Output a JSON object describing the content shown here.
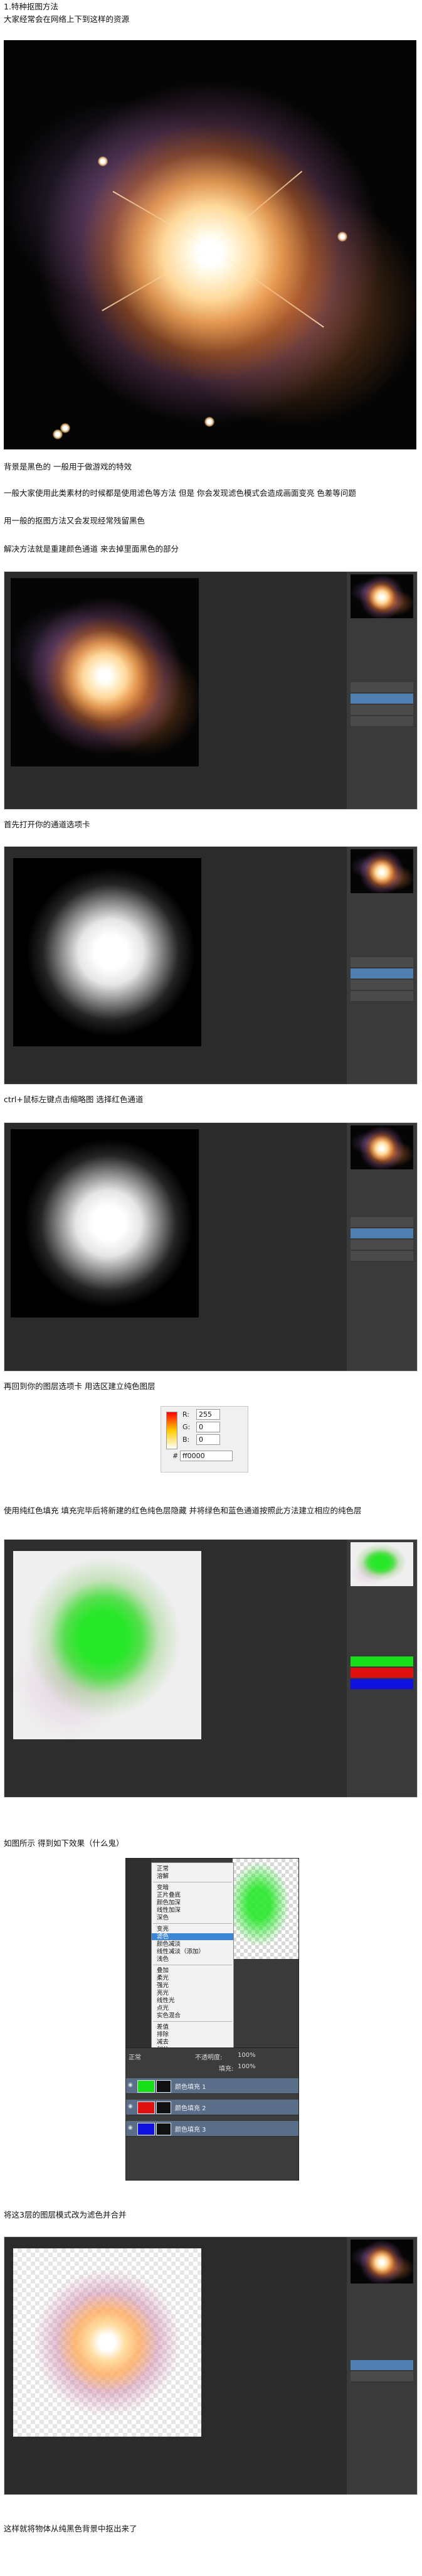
{
  "texts": {
    "t1": "1.特种抠图方法",
    "t2": "大家经常会在网络上下到这样的资源",
    "t3": "背景是黑色的 一般用于做游戏的特效",
    "t4": "一般大家使用此类素材的时候都是使用滤色等方法 但是 你会发现滤色模式会造成画面变亮 色差等问题",
    "t5": "用一般的抠图方法又会发现经常残留黑色",
    "t6": "解决方法就是重建颜色通道 来去掉里面黑色的部分",
    "t7": "首先打开你的通道选项卡",
    "t8": "ctrl+鼠标左键点击缩略图 选择红色通道",
    "t9": "再回到你的图层选项卡 用选区建立纯色图层",
    "t10": "使用纯红色填充 填充完毕后将新建的红色纯色层隐藏 并将绿色和蓝色通道按照此方法建立相应的纯色层",
    "t11": "如图所示 得到如下效果（什么鬼）",
    "t12": "将这3层的图层模式改为滤色并合并",
    "t13": "这样就将物体从纯黑色背景中抠出来了"
  },
  "picker": {
    "r_label": "R:",
    "r_value": "255",
    "g_label": "G:",
    "g_value": "0",
    "b_label": "B:",
    "b_value": "0",
    "hex_label": "#",
    "hex_value": "ff0000"
  },
  "menu": {
    "items": [
      "正常",
      "溶解",
      "变暗",
      "正片叠底",
      "颜色加深",
      "线性加深",
      "深色",
      "变亮",
      "滤色",
      "颜色减淡",
      "线性减淡（添加）",
      "浅色",
      "叠加",
      "柔光",
      "强光",
      "亮光",
      "线性光",
      "点光",
      "实色混合",
      "差值",
      "排除",
      "减去",
      "划分",
      "色相",
      "饱和度",
      "颜色",
      "明度"
    ],
    "highlighted": "滤色"
  },
  "layers": {
    "mode": "正常",
    "opacity_label": "不透明度:",
    "opacity_value": "100%",
    "fill_label": "填充:",
    "fill_value": "100%",
    "rows": [
      {
        "name": "颜色填充 1",
        "color": "#18e018"
      },
      {
        "name": "颜色填充 2",
        "color": "#e01010"
      },
      {
        "name": "颜色填充 3",
        "color": "#1010e0"
      }
    ]
  },
  "colors": {
    "accent_blue": "#3d86d6",
    "ps_bg": "#2b2b2b",
    "green": "#28e82a"
  }
}
